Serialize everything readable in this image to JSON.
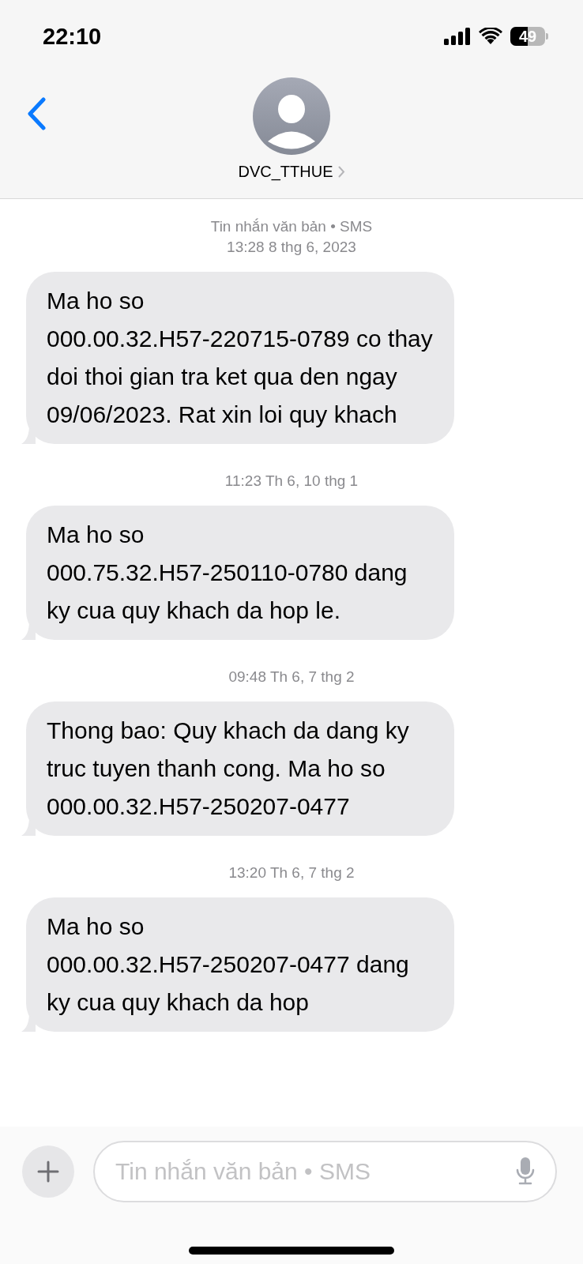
{
  "status_bar": {
    "time": "22:10",
    "battery": "49"
  },
  "header": {
    "contact_name": "DVC_TTHUE"
  },
  "messages": [
    {
      "service": "Tin nhắn văn bản • SMS",
      "timestamp": "13:28 8 thg 6, 2023",
      "text": "Ma ho so 000.00.32.H57-220715-0789 co thay doi thoi gian tra ket qua den ngay 09/06/2023. Rat xin loi quy khach"
    },
    {
      "timestamp": "11:23 Th 6, 10 thg 1",
      "text": "Ma ho so 000.75.32.H57-250110-0780 dang ky cua quy khach da hop le."
    },
    {
      "timestamp": "09:48 Th 6, 7 thg 2",
      "text": "Thong bao: Quy khach da dang ky truc tuyen thanh cong. Ma ho so 000.00.32.H57-250207-0477"
    },
    {
      "timestamp": "13:20 Th 6, 7 thg 2",
      "text": "Ma ho so 000.00.32.H57-250207-0477 dang ky cua quy khach da hop"
    }
  ],
  "composer": {
    "placeholder": "Tin nhắn văn bản • SMS"
  }
}
